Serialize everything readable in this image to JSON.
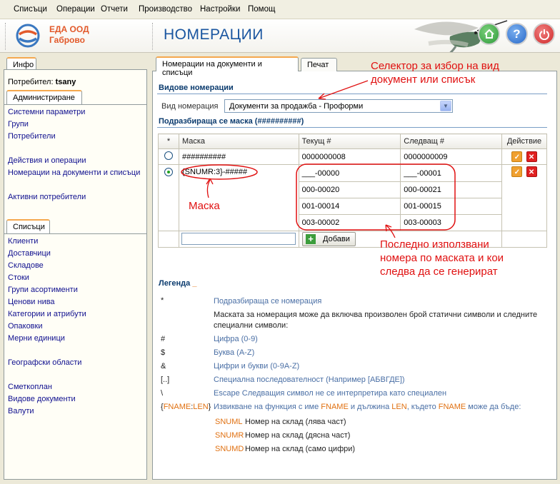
{
  "menu": [
    "Списъци",
    "Операции",
    "Отчети",
    "Производство",
    "Настройки",
    "Помощ"
  ],
  "company": {
    "name": "ЕДА ООД",
    "city": "Габрово"
  },
  "page_title": "НОМЕРАЦИИ",
  "header_buttons": {
    "home": "home-icon",
    "help": "?",
    "power": "power-icon"
  },
  "left": {
    "tab_info": "Инфо",
    "user_label": "Потребител:",
    "user_name": "tsany",
    "tab_admin": "Администриране",
    "admin_links": [
      "Системни параметри",
      "Групи",
      "Потребители",
      "Действия и операции",
      "Номерации на документи и списъци",
      "Активни потребители"
    ],
    "tab_lists": "Списъци",
    "list_links": [
      "Клиенти",
      "Доставчици",
      "Складове",
      "Стоки",
      "Групи асортименти",
      "Ценови нива",
      "Категории и атрибути",
      "Опаковки",
      "Мерни единици",
      "Географски области",
      "Сметкоплан",
      "Видове документи",
      "Валути"
    ]
  },
  "main": {
    "tab_numbering": "Номерации на документи и списъци",
    "tab_print": "Печат",
    "section_types": "Видове номерации",
    "type_label": "Вид номерация",
    "type_value": "Документи за продажба - Проформи",
    "section_default": "Подразбираща се маска (##########)",
    "columns": [
      "*",
      "Маска",
      "Текущ #",
      "Следващ #",
      "Действие"
    ],
    "row1": {
      "mask": "##########",
      "current": "0000000008",
      "next": "0000000009"
    },
    "row2": {
      "mask": "{SNUMR:3}-#####",
      "items": [
        {
          "current": "___-00000",
          "next": "___-00001"
        },
        {
          "current": "000-00020",
          "next": "000-00021"
        },
        {
          "current": "001-00014",
          "next": "001-00015"
        },
        {
          "current": "003-00002",
          "next": "003-00003"
        }
      ]
    },
    "add_button": "Добави",
    "legend_title": "Легенда",
    "legend_underscore": "_",
    "legend": {
      "default_sym": "*",
      "default_desc": "Подразбираща се номерация",
      "intro": "Маската за номерация може да включва произволен брой статични символи и следните специални символи:",
      "items": [
        {
          "sym": "#",
          "desc": "Цифра (0-9)"
        },
        {
          "sym": "$",
          "desc": "Буква (A-Z)"
        },
        {
          "sym": "&",
          "desc": "Цифри и букви (0-9A-Z)"
        },
        {
          "sym": "[..]",
          "desc": "Специална последователност (Например [АБВГДЕ])"
        },
        {
          "sym": "\\",
          "desc": "Escape Следващия символ не се интерпретира като специален"
        }
      ],
      "func_sym_open": "{",
      "func_sym_fname": "FNAME",
      "func_sym_colon": ":",
      "func_sym_len": "LEN",
      "func_sym_close": "}",
      "func_desc_1": "Извикване на функция с име ",
      "func_desc_fname": "FNAME",
      "func_desc_2": " и дължина ",
      "func_desc_len": "LEN",
      "func_desc_3": ", където ",
      "func_desc_fname2": "FNAME",
      "func_desc_4": " може да бъде:",
      "codes": [
        {
          "code": "SNUML",
          "desc": "Номер на склад (лява част)"
        },
        {
          "code": "SNUMR",
          "desc": "Номер на склад (дясна част)"
        },
        {
          "code": "SNUMD",
          "desc": "Номер на склад (само цифри)"
        }
      ]
    }
  },
  "annotations": {
    "selector_line1": "Селектор за избор на вид",
    "selector_line2": "документ или списък",
    "mask": "Маска",
    "last_line1": "Последно използвани",
    "last_line2": "номера по маската и кои",
    "last_line3": "следва да се генерират",
    "color": "#e01010"
  }
}
